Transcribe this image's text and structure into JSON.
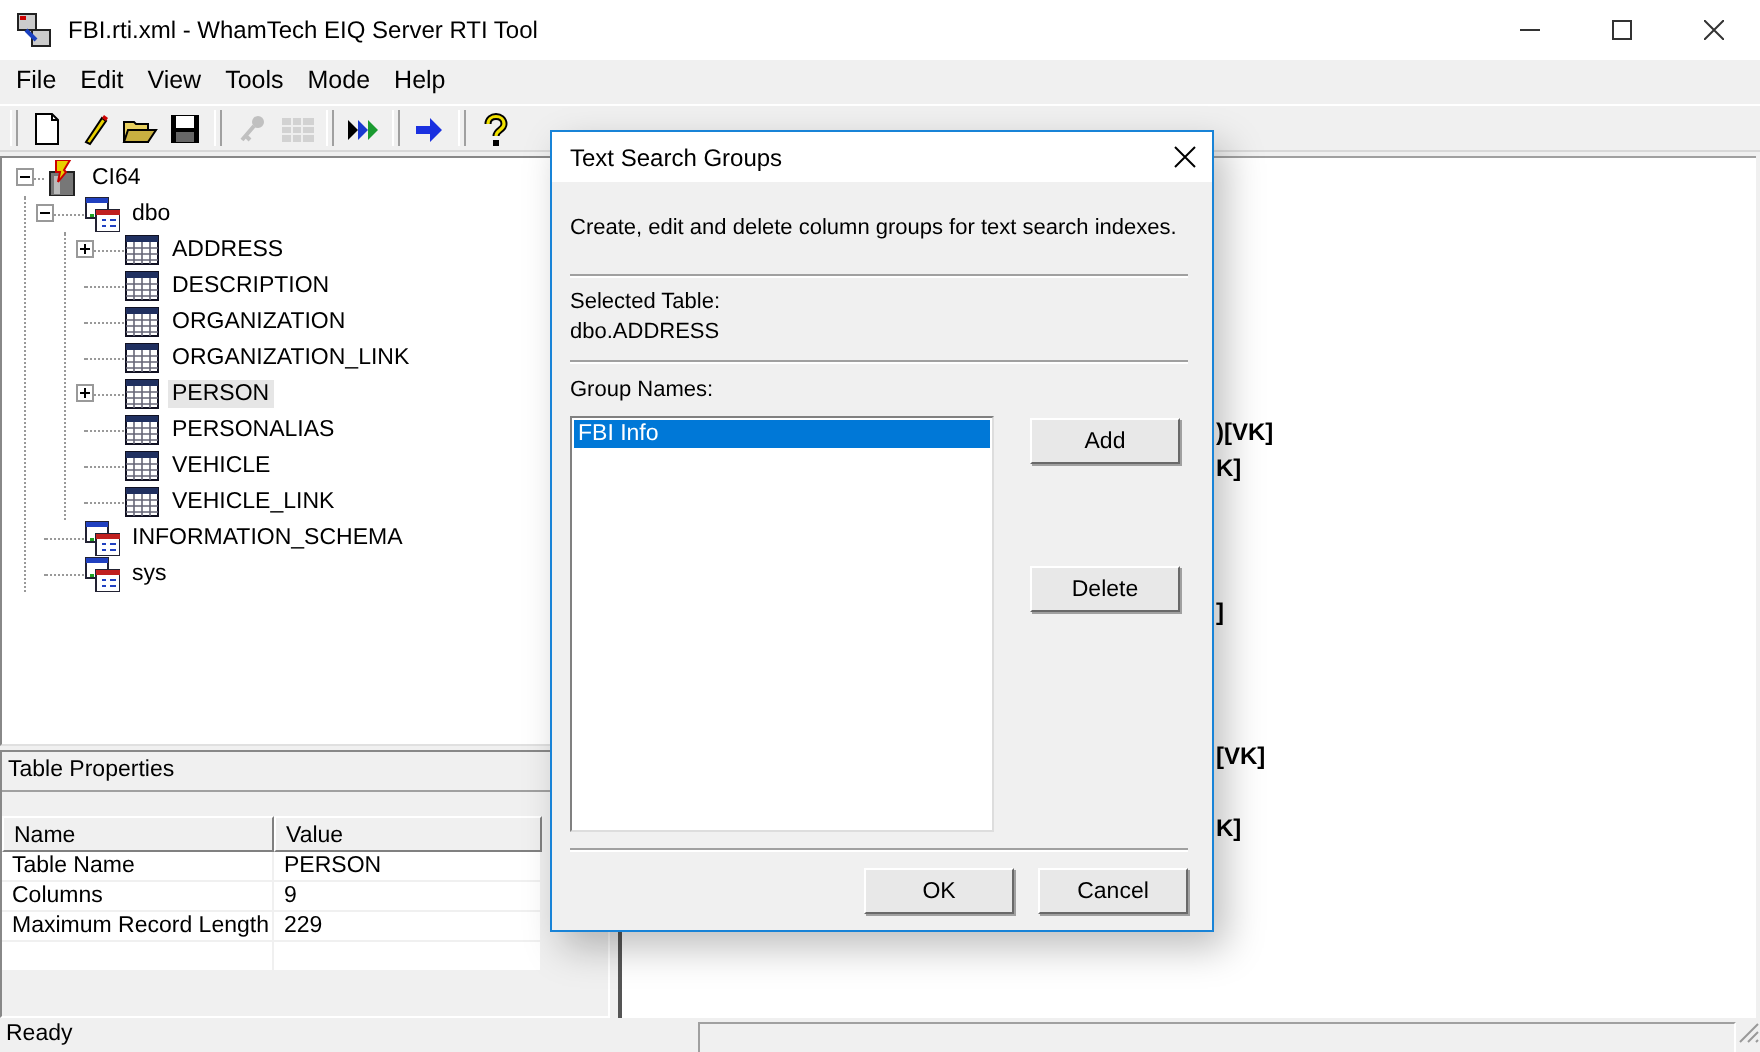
{
  "window": {
    "title": "FBI.rti.xml - WhamTech EIQ Server RTI Tool"
  },
  "menu": [
    {
      "label": "File"
    },
    {
      "label": "Edit"
    },
    {
      "label": "View"
    },
    {
      "label": "Tools"
    },
    {
      "label": "Mode"
    },
    {
      "label": "Help"
    }
  ],
  "toolbar": [
    {
      "kind": "new",
      "disabled": false
    },
    {
      "kind": "edit",
      "disabled": false
    },
    {
      "kind": "open",
      "disabled": false
    },
    {
      "kind": "save",
      "disabled": false
    },
    {
      "kind": "sep"
    },
    {
      "kind": "key",
      "disabled": true
    },
    {
      "kind": "grid",
      "disabled": true
    },
    {
      "kind": "sep"
    },
    {
      "kind": "run-all",
      "disabled": false
    },
    {
      "kind": "sep"
    },
    {
      "kind": "run",
      "disabled": false
    },
    {
      "kind": "sep"
    },
    {
      "kind": "help",
      "disabled": false
    }
  ],
  "tree": [
    {
      "label": "CI64",
      "kind": "database",
      "expanded": true,
      "selected": false,
      "children": [
        {
          "label": "dbo",
          "kind": "schema",
          "expanded": true,
          "selected": false,
          "children": [
            {
              "label": "ADDRESS",
              "kind": "table",
              "expanded": false,
              "selected": false
            },
            {
              "label": "DESCRIPTION",
              "kind": "table",
              "selected": false
            },
            {
              "label": "ORGANIZATION",
              "kind": "table",
              "selected": false
            },
            {
              "label": "ORGANIZATION_LINK",
              "kind": "table",
              "selected": false
            },
            {
              "label": "PERSON",
              "kind": "table",
              "expanded": false,
              "selected": true
            },
            {
              "label": "PERSONALIAS",
              "kind": "table",
              "selected": false
            },
            {
              "label": "VEHICLE",
              "kind": "table",
              "selected": false
            },
            {
              "label": "VEHICLE_LINK",
              "kind": "table",
              "selected": false
            }
          ]
        },
        {
          "label": "INFORMATION_SCHEMA",
          "kind": "schema",
          "selected": false
        },
        {
          "label": "sys",
          "kind": "schema",
          "selected": false
        }
      ]
    }
  ],
  "properties": {
    "title": "Table Properties",
    "columns": [
      "Name",
      "Value"
    ],
    "rows": [
      [
        "Table Name",
        "PERSON"
      ],
      [
        "Columns",
        "9"
      ],
      [
        "Maximum Record Length",
        "229"
      ]
    ]
  },
  "text_lines": [
    {
      "text": ")[VK]"
    },
    {
      "text": "K]"
    },
    {
      "text": "]"
    },
    {
      "text": "[VK]"
    },
    {
      "text": "K]"
    }
  ],
  "dialog": {
    "title": "Text Search Groups",
    "description": "Create, edit and delete column groups for text search indexes.",
    "selected_table_label": "Selected Table:",
    "selected_table": "dbo.ADDRESS",
    "group_names_label": "Group Names:",
    "groups": [
      {
        "label": "FBI Info",
        "selected": true
      }
    ],
    "side_buttons": [
      "Add",
      "Delete"
    ],
    "buttons": [
      "OK",
      "Cancel"
    ]
  },
  "status_bar": {
    "text": "Ready"
  }
}
